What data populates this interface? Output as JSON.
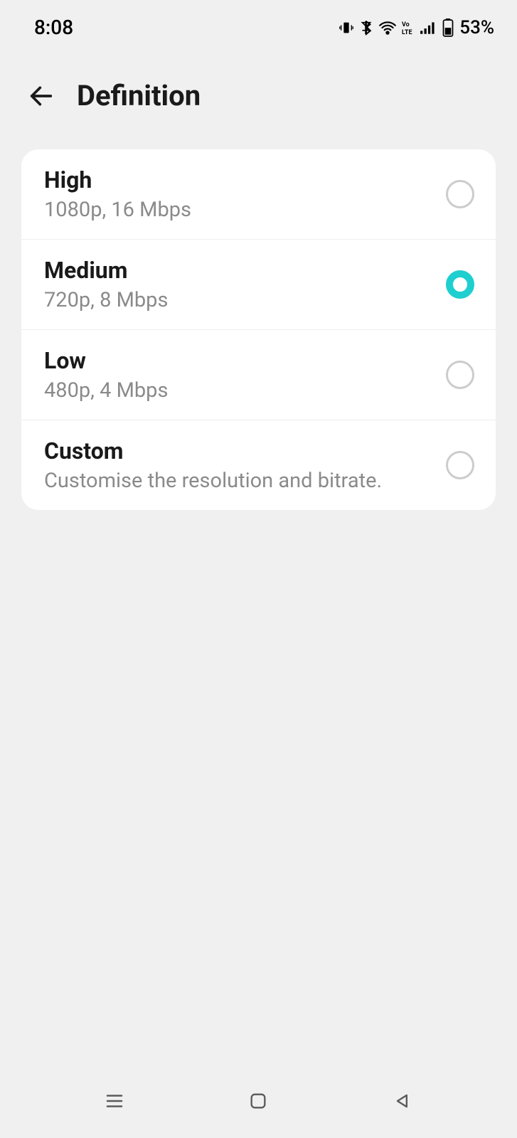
{
  "status": {
    "time": "8:08",
    "battery": "53%"
  },
  "header": {
    "title": "Definition"
  },
  "options": [
    {
      "label": "High",
      "desc": "1080p, 16 Mbps",
      "selected": false
    },
    {
      "label": "Medium",
      "desc": "720p, 8 Mbps",
      "selected": true
    },
    {
      "label": "Low",
      "desc": "480p, 4 Mbps",
      "selected": false
    },
    {
      "label": "Custom",
      "desc": "Customise the resolution and bitrate.",
      "selected": false
    }
  ]
}
